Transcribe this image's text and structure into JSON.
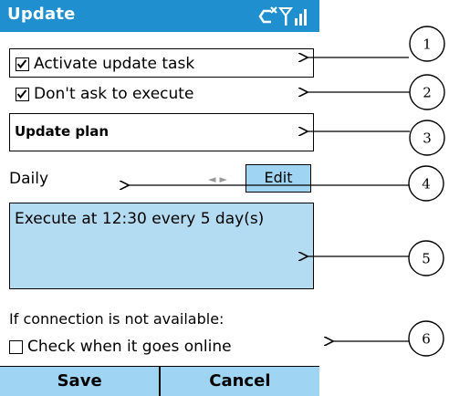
{
  "title_bar": {
    "title": "Update",
    "icons": [
      "connectivity-icon",
      "signal-strength-icon"
    ]
  },
  "options": {
    "activate_update_task": {
      "label": "Activate update task",
      "checked": true
    },
    "dont_ask_to_execute": {
      "label": "Don't ask to execute",
      "checked": true
    }
  },
  "update_plan": {
    "title": "Update plan"
  },
  "frequency": {
    "value": "Daily",
    "edit_label": "Edit"
  },
  "schedule": {
    "text": "Execute at 12:30 every 5 day(s)"
  },
  "connection": {
    "label": "If connection is not available:",
    "check_online": {
      "label": "Check when it goes online",
      "checked": false
    }
  },
  "softkeys": {
    "left": "Save",
    "right": "Cancel"
  },
  "callouts": [
    "1",
    "2",
    "3",
    "4",
    "5",
    "6"
  ],
  "colors": {
    "title_bar": "#1f8fd0",
    "softkey_bar": "#9fd4f2",
    "schedule_bg": "#b3dcf2"
  }
}
